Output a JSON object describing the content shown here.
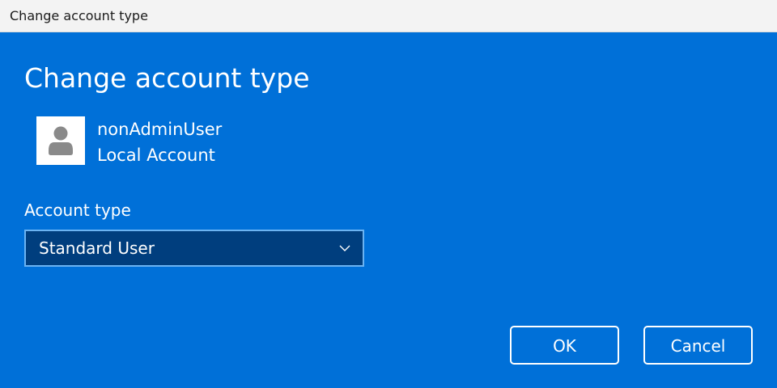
{
  "window": {
    "title": "Change account type"
  },
  "dialog": {
    "heading": "Change account type",
    "user": {
      "name": "nonAdminUser",
      "account_kind": "Local Account",
      "avatar_icon": "user-silhouette-icon"
    },
    "account_type": {
      "label": "Account type",
      "selected": "Standard User",
      "dropdown_icon": "chevron-down-icon"
    },
    "buttons": {
      "ok": "OK",
      "cancel": "Cancel"
    }
  },
  "colors": {
    "background": "#0070d8",
    "select_background": "#003e7e",
    "select_border": "#6bb3f2",
    "titlebar": "#f3f3f3",
    "text": "#ffffff",
    "avatar_glyph": "#8a8a8a"
  }
}
